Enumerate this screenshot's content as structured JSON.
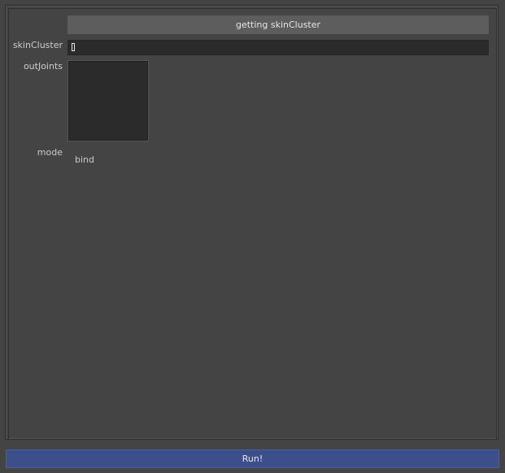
{
  "toolbar": {
    "get_skincluster_label": "getting skinCluster"
  },
  "fields": {
    "skincluster_label": "skinCluster",
    "skincluster_value": "",
    "outjoints_label": "outJoints",
    "mode_label": "mode",
    "mode_value": "bind"
  },
  "footer": {
    "run_label": "Run!"
  },
  "colors": {
    "background": "#444444",
    "field_background": "#2b2b2b",
    "button_background": "#5d5d5d",
    "run_button_background": "#3d4f8a"
  }
}
